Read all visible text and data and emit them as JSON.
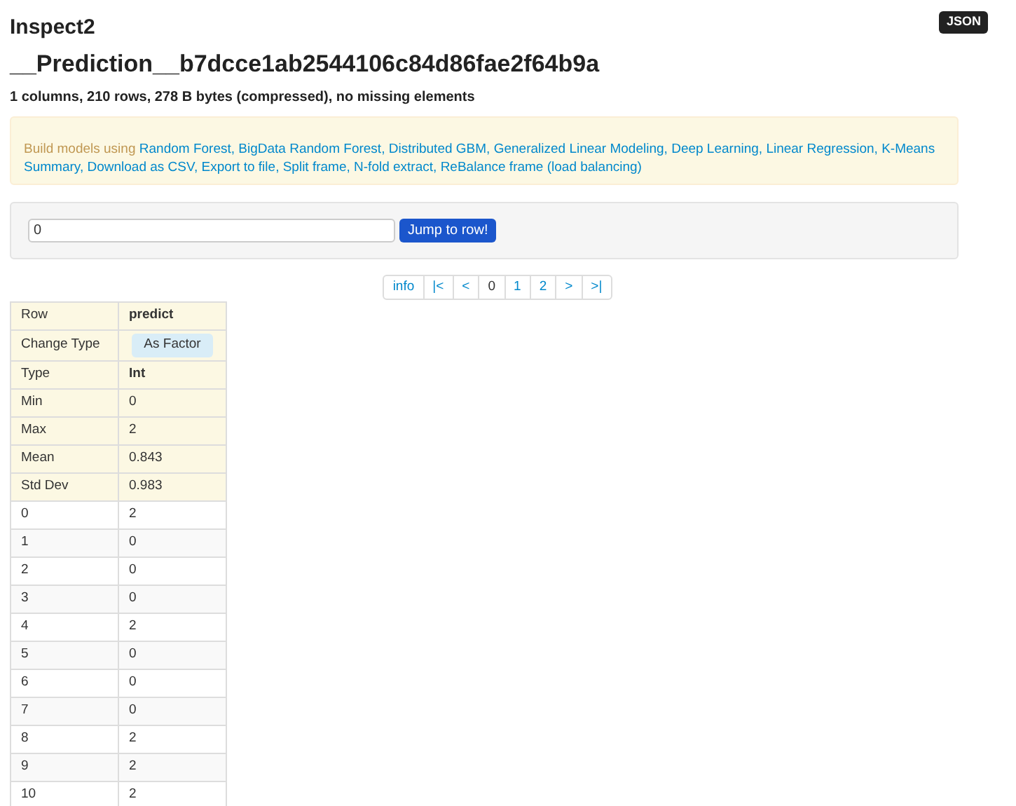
{
  "json_button": "JSON",
  "title": "Inspect2",
  "frame_name": "__Prediction__b7dcce1ab2544106c84d86fae2f64b9a",
  "summary": "1 columns, 210 rows, 278 B bytes (compressed), no missing elements",
  "separator": ",",
  "build_models": {
    "prefix": "Build models using",
    "links": [
      "Random Forest",
      "BigData Random Forest",
      "Distributed GBM",
      "Generalized Linear Modeling",
      "Deep Learning",
      "Linear Regression",
      "K-Means"
    ]
  },
  "actions": [
    "Summary",
    "Download as CSV",
    "Export to file",
    "Split frame",
    "N-fold extract",
    "ReBalance frame (load balancing)"
  ],
  "jump": {
    "value": "0",
    "button": "Jump to row!"
  },
  "pagination": [
    {
      "label": "info",
      "selected": false
    },
    {
      "label": "|<",
      "selected": false
    },
    {
      "label": "<",
      "selected": false
    },
    {
      "label": "0",
      "selected": true
    },
    {
      "label": "1",
      "selected": false
    },
    {
      "label": "2",
      "selected": false
    },
    {
      "label": ">",
      "selected": false
    },
    {
      "label": ">|",
      "selected": false
    }
  ],
  "table": {
    "header": {
      "label": "Row",
      "column": "predict"
    },
    "change_type": {
      "label": "Change Type",
      "button": "As Factor"
    },
    "stats": [
      {
        "kind": "type",
        "label": "Type",
        "value": "Int"
      },
      {
        "kind": "stat",
        "label": "Min",
        "value": "0"
      },
      {
        "kind": "stat",
        "label": "Max",
        "value": "2"
      },
      {
        "kind": "stat",
        "label": "Mean",
        "value": "0.843"
      },
      {
        "kind": "stat",
        "label": "Std Dev",
        "value": "0.983"
      }
    ],
    "rows": [
      {
        "row": "0",
        "value": "2"
      },
      {
        "row": "1",
        "value": "0"
      },
      {
        "row": "2",
        "value": "0"
      },
      {
        "row": "3",
        "value": "0"
      },
      {
        "row": "4",
        "value": "2"
      },
      {
        "row": "5",
        "value": "0"
      },
      {
        "row": "6",
        "value": "0"
      },
      {
        "row": "7",
        "value": "0"
      },
      {
        "row": "8",
        "value": "2"
      },
      {
        "row": "9",
        "value": "2"
      },
      {
        "row": "10",
        "value": "2"
      }
    ]
  }
}
